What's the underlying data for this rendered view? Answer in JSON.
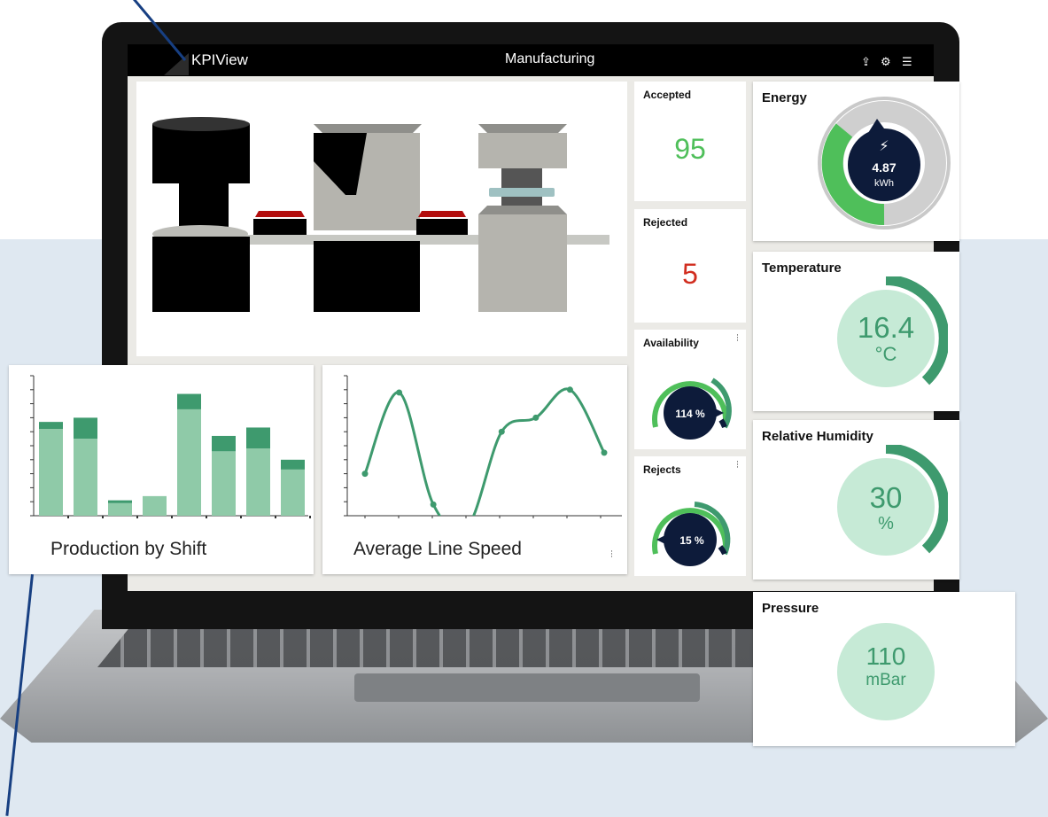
{
  "header": {
    "app_name": "KPIView",
    "title": "Manufacturing"
  },
  "tiles": {
    "accepted": {
      "title": "Accepted",
      "value": "95",
      "color": "#4fbf5a"
    },
    "rejected": {
      "title": "Rejected",
      "value": "5",
      "color": "#d12d1f"
    },
    "availability": {
      "title": "Availability",
      "value": "114 %",
      "level": 0.8
    },
    "rejects": {
      "title": "Rejects",
      "value": "15 %",
      "level": 0.62
    }
  },
  "cards": {
    "production": {
      "label": "Production by Shift"
    },
    "line_speed": {
      "label": "Average Line Speed"
    },
    "energy": {
      "title": "Energy",
      "value": "4.87",
      "unit": "kWh"
    },
    "temperature": {
      "title": "Temperature",
      "value": "16.4",
      "unit": "°C"
    },
    "humidity": {
      "title": "Relative Humidity",
      "value": "30",
      "unit": "%"
    },
    "pressure": {
      "title": "Pressure",
      "value": "110",
      "unit": "mBar"
    }
  },
  "colors": {
    "accent_green": "#3e9a6e",
    "bar_light": "#8fcaa8",
    "bar_dark": "#3e9a6e",
    "navy": "#0d1b3a",
    "callout": "#173f82"
  },
  "chart_data": [
    {
      "type": "bar",
      "series": [
        {
          "values": [
            62,
            55,
            9,
            14,
            76,
            46,
            48,
            33
          ]
        },
        {
          "values": [
            5,
            15,
            2,
            0,
            11,
            11,
            15,
            7
          ]
        }
      ],
      "ylim": [
        0,
        100
      ]
    },
    {
      "type": "line",
      "x": [
        0,
        1,
        2,
        3,
        4,
        5,
        6,
        7
      ],
      "y": [
        30,
        88,
        8,
        -8,
        60,
        70,
        90,
        45
      ],
      "ylim": [
        0,
        100
      ]
    }
  ]
}
